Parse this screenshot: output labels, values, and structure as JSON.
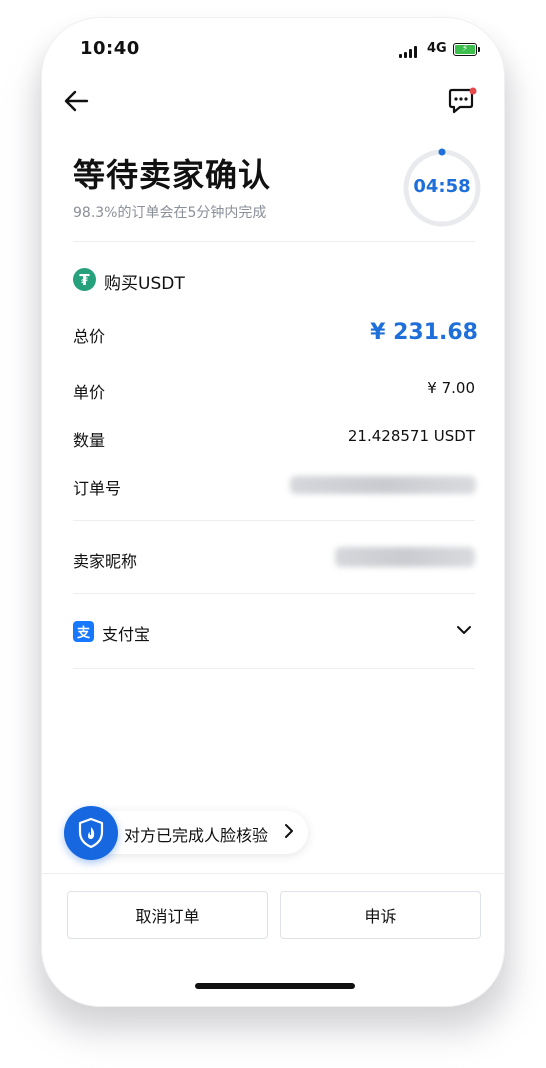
{
  "status_bar": {
    "time": "10:40",
    "network": "4G",
    "battery_icon": "battery-charging-icon"
  },
  "header": {
    "back_icon": "back-arrow-icon",
    "chat_icon": "chat-notification-icon"
  },
  "order_status": {
    "title": "等待卖家确认",
    "subtitle": "98.3%的订单会在5分钟内完成",
    "countdown": "04:58"
  },
  "asset": {
    "coin_symbol": "₮",
    "label": "购买USDT"
  },
  "details": {
    "total_label": "总价",
    "total_value": "¥ 231.68",
    "unit_price_label": "单价",
    "unit_price_value": "¥ 7.00",
    "quantity_label": "数量",
    "quantity_value": "21.428571 USDT",
    "order_no_label": "订单号"
  },
  "seller": {
    "nickname_label": "卖家昵称"
  },
  "payment": {
    "method_icon": "支",
    "method_label": "支付宝"
  },
  "face_verification": {
    "label": "对方已完成人脸核验"
  },
  "actions": {
    "cancel_label": "取消订单",
    "appeal_label": "申诉"
  },
  "colors": {
    "accent": "#1e6fd9",
    "usdt": "#26a17b",
    "alipay": "#1677ff",
    "battery": "#3cbf4d",
    "notification_dot": "#e5484d"
  }
}
